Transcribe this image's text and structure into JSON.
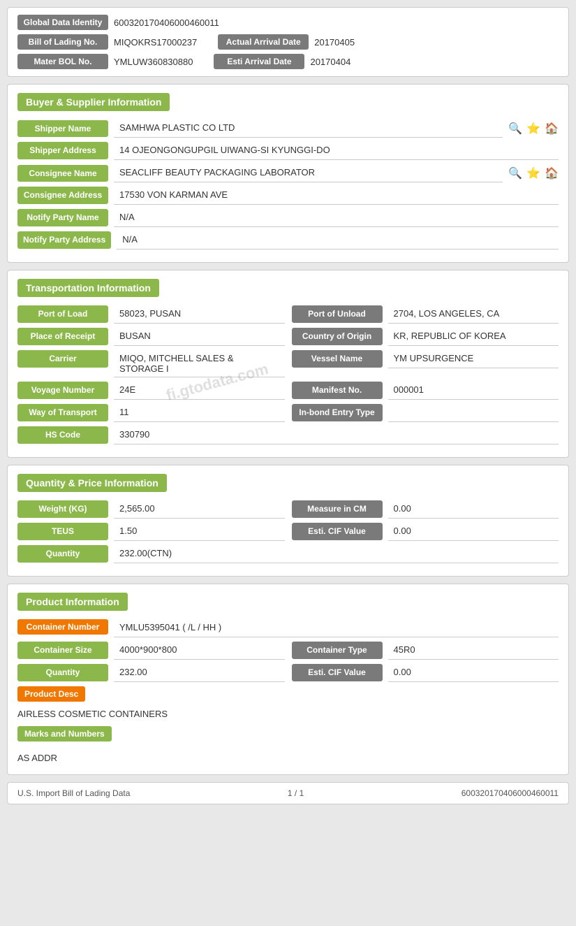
{
  "global": {
    "identity_label": "Global Data Identity",
    "identity_value": "600320170406000460011"
  },
  "bol": {
    "label": "Bill of Lading No.",
    "value": "MIQOKRS17000237",
    "actual_arrival_label": "Actual Arrival Date",
    "actual_arrival_value": "20170405"
  },
  "master_bol": {
    "label": "Mater BOL No.",
    "value": "YMLUW360830880",
    "esti_arrival_label": "Esti Arrival Date",
    "esti_arrival_value": "20170404"
  },
  "buyer_supplier": {
    "section_title": "Buyer & Supplier Information",
    "shipper_name_label": "Shipper Name",
    "shipper_name_value": "SAMHWA PLASTIC CO LTD",
    "shipper_address_label": "Shipper Address",
    "shipper_address_value": "14 OJEONGONGUPGIL UIWANG-SI KYUNGGI-DO",
    "consignee_name_label": "Consignee Name",
    "consignee_name_value": "SEACLIFF BEAUTY PACKAGING LABORATOR",
    "consignee_address_label": "Consignee Address",
    "consignee_address_value": "17530 VON KARMAN AVE",
    "notify_party_name_label": "Notify Party Name",
    "notify_party_name_value": "N/A",
    "notify_party_address_label": "Notify Party Address",
    "notify_party_address_value": "N/A"
  },
  "transportation": {
    "section_title": "Transportation Information",
    "port_of_load_label": "Port of Load",
    "port_of_load_value": "58023, PUSAN",
    "port_of_unload_label": "Port of Unload",
    "port_of_unload_value": "2704, LOS ANGELES, CA",
    "place_of_receipt_label": "Place of Receipt",
    "place_of_receipt_value": "BUSAN",
    "country_of_origin_label": "Country of Origin",
    "country_of_origin_value": "KR, REPUBLIC OF KOREA",
    "carrier_label": "Carrier",
    "carrier_value": "MIQO, MITCHELL SALES & STORAGE I",
    "vessel_name_label": "Vessel Name",
    "vessel_name_value": "YM UPSURGENCE",
    "voyage_number_label": "Voyage Number",
    "voyage_number_value": "24E",
    "manifest_no_label": "Manifest No.",
    "manifest_no_value": "000001",
    "way_of_transport_label": "Way of Transport",
    "way_of_transport_value": "11",
    "in_bond_entry_label": "In-bond Entry Type",
    "in_bond_entry_value": "",
    "hs_code_label": "HS Code",
    "hs_code_value": "330790"
  },
  "quantity_price": {
    "section_title": "Quantity & Price Information",
    "weight_label": "Weight (KG)",
    "weight_value": "2,565.00",
    "measure_label": "Measure in CM",
    "measure_value": "0.00",
    "teus_label": "TEUS",
    "teus_value": "1.50",
    "esti_cif_label": "Esti. CIF Value",
    "esti_cif_value": "0.00",
    "quantity_label": "Quantity",
    "quantity_value": "232.00(CTN)"
  },
  "product": {
    "section_title": "Product Information",
    "container_number_label": "Container Number",
    "container_number_value": "YMLU5395041 ( /L / HH )",
    "container_size_label": "Container Size",
    "container_size_value": "4000*900*800",
    "container_type_label": "Container Type",
    "container_type_value": "45R0",
    "quantity_label": "Quantity",
    "quantity_value": "232.00",
    "esti_cif_label": "Esti. CIF Value",
    "esti_cif_value": "0.00",
    "product_desc_label": "Product Desc",
    "product_desc_value": "AIRLESS COSMETIC CONTAINERS",
    "marks_label": "Marks and Numbers",
    "marks_value": "AS ADDR"
  },
  "footer": {
    "left": "U.S. Import Bill of Lading Data",
    "center": "1 / 1",
    "right": "600320170406000460011"
  },
  "watermark": "fi.gtodata.com",
  "icons": {
    "search": "🔍",
    "star": "⭐",
    "home": "🏠"
  }
}
